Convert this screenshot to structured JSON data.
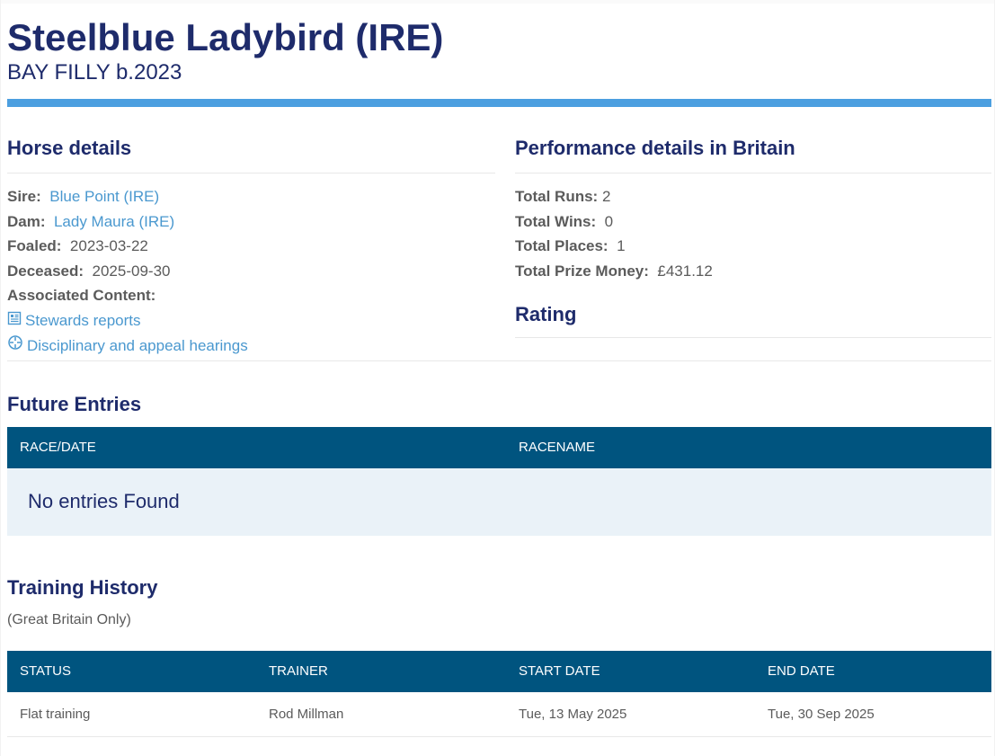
{
  "horse": {
    "name": "Steelblue Ladybird (IRE)",
    "subtitle": "BAY FILLY b.2023"
  },
  "horse_details": {
    "title": "Horse details",
    "sire_label": "Sire:",
    "sire_value": "Blue Point (IRE)",
    "dam_label": "Dam:",
    "dam_value": "Lady Maura (IRE)",
    "foaled_label": "Foaled:",
    "foaled_value": "2023-03-22",
    "deceased_label": "Deceased:",
    "deceased_value": "2025-09-30",
    "associated_label": "Associated Content:",
    "links": [
      {
        "label": "Stewards reports",
        "icon": "document-icon"
      },
      {
        "label": "Disciplinary and appeal hearings",
        "icon": "crosshair-icon"
      }
    ]
  },
  "performance": {
    "title": "Performance details in Britain",
    "runs_label": "Total Runs:",
    "runs_value": "2",
    "wins_label": "Total Wins:",
    "wins_value": "0",
    "places_label": "Total Places:",
    "places_value": "1",
    "prize_label": "Total Prize Money:",
    "prize_value": "£431.12",
    "rating_title": "Rating"
  },
  "future_entries": {
    "title": "Future Entries",
    "columns": [
      "RACE/DATE",
      "RACENAME"
    ],
    "empty_text": "No entries Found"
  },
  "training_history": {
    "title": "Training History",
    "note": "(Great Britain Only)",
    "columns": [
      "STATUS",
      "TRAINER",
      "START DATE",
      "END DATE"
    ],
    "rows": [
      [
        "Flat training",
        "Rod Millman",
        "Tue, 13 May 2025",
        "Tue, 30 Sep 2025"
      ]
    ]
  },
  "colors": {
    "navy": "#1e2b6b",
    "link": "#4a98cf",
    "header_bg": "#00547f",
    "accent_bar": "#4c9fe0"
  }
}
